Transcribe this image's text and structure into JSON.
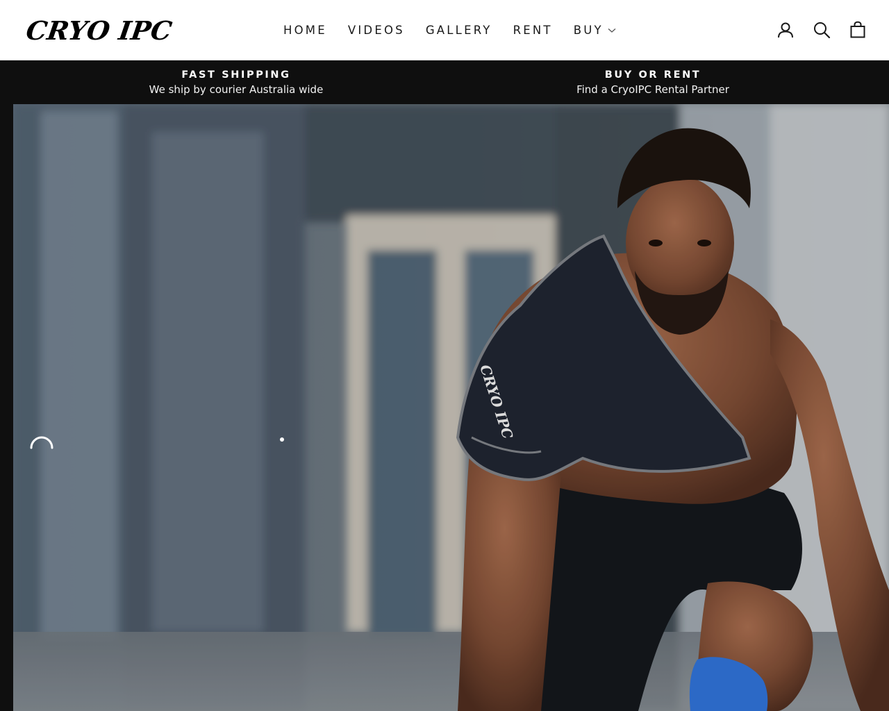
{
  "brand": {
    "logo_text": "CRYO IPC"
  },
  "nav": {
    "items": [
      {
        "label": "HOME"
      },
      {
        "label": "VIDEOS"
      },
      {
        "label": "GALLERY"
      },
      {
        "label": "RENT"
      },
      {
        "label": "BUY",
        "has_dropdown": true
      }
    ]
  },
  "header_icons": [
    "user-icon",
    "search-icon",
    "cart-icon"
  ],
  "announcements": [
    {
      "title": "FAST SHIPPING",
      "subtitle": "We ship by courier Australia wide"
    },
    {
      "title": "BUY OR RENT",
      "subtitle": "Find a CryoIPC Rental Partner"
    }
  ],
  "hero": {
    "image_subject": "athlete in sprint start stance wearing cryo compression shoulder wrap",
    "wrap_text": "CRYO IPC"
  },
  "colors": {
    "header_bg": "#ffffff",
    "bar_bg": "#0f0f0f",
    "text_dark": "#1a1a1a",
    "text_light": "#ffffff"
  }
}
